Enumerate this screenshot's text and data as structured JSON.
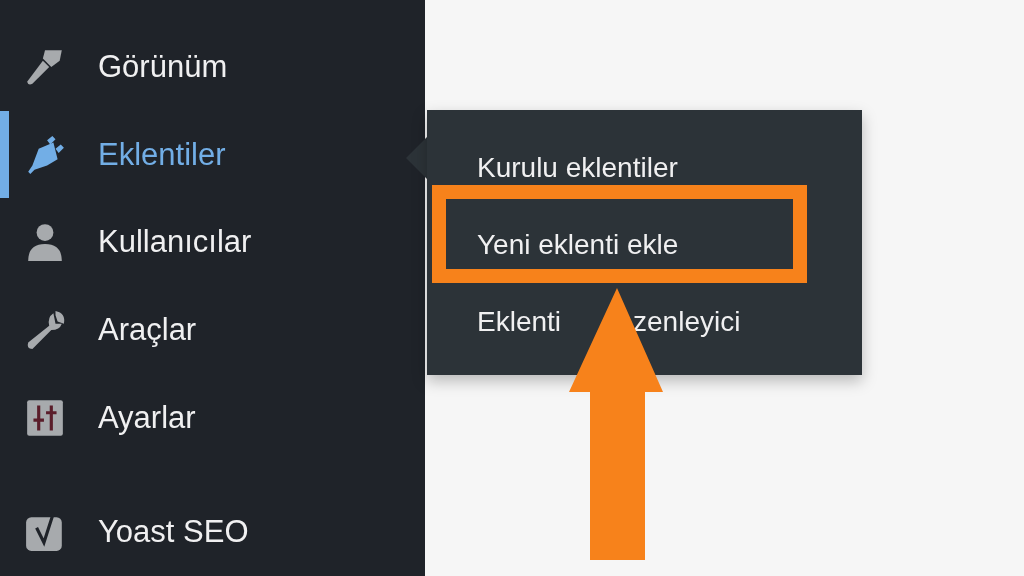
{
  "sidebar": {
    "items": [
      {
        "label": "Görünüm",
        "kind": "brush",
        "selected": false
      },
      {
        "label": "Eklentiler",
        "kind": "plug",
        "selected": true
      },
      {
        "label": "Kullanıcılar",
        "kind": "user",
        "selected": false
      },
      {
        "label": "Araçlar",
        "kind": "wrench",
        "selected": false
      },
      {
        "label": "Ayarlar",
        "kind": "sliders",
        "selected": false
      },
      {
        "label": "Yoast SEO",
        "kind": "yoast",
        "selected": false
      }
    ]
  },
  "flyout": {
    "items": [
      {
        "label": "Kurulu eklentiler",
        "highlighted": false
      },
      {
        "label": "Yeni eklenti ekle",
        "highlighted": true
      },
      {
        "label": "Eklenti",
        "label_after_arrow": "zenleyici",
        "highlighted": false
      }
    ]
  }
}
